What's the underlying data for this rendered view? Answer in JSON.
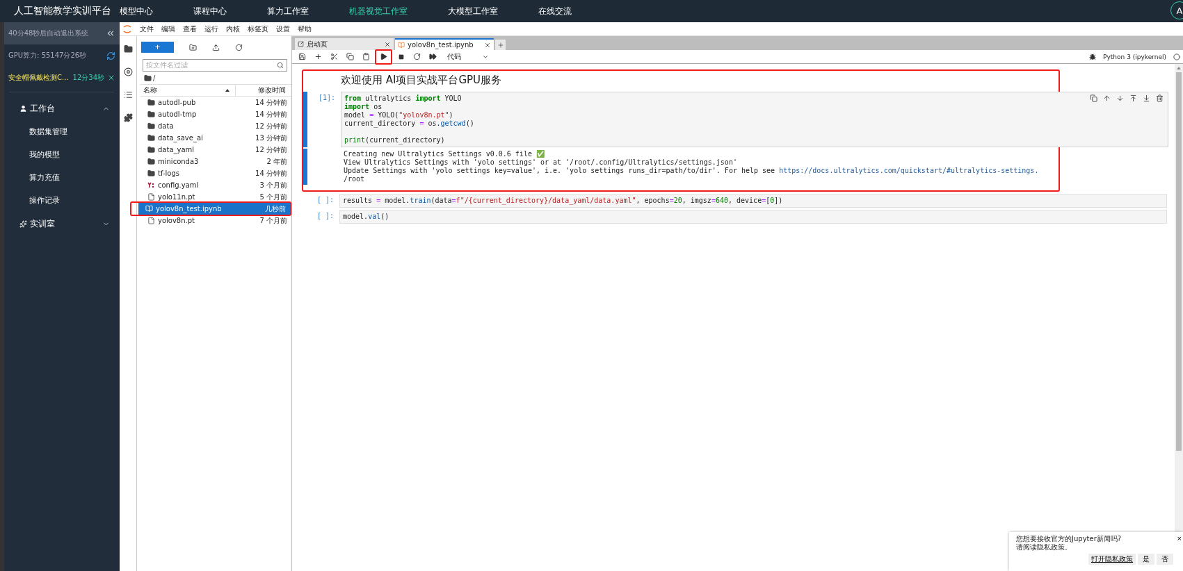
{
  "topbar": {
    "title": "人工智能教学实训平台",
    "avatar": "A",
    "nav": [
      {
        "label": "模型中心",
        "selected": false
      },
      {
        "label": "课程中心",
        "selected": false
      },
      {
        "label": "算力工作室",
        "selected": false
      },
      {
        "label": "机器视觉工作室",
        "selected": true
      },
      {
        "label": "大模型工作室",
        "selected": false
      },
      {
        "label": "在线交流",
        "selected": false
      }
    ]
  },
  "sidebar": {
    "timer": "40分48秒后自动退出系统",
    "gpu": "GPU算力: 55147分26秒",
    "task": {
      "name": "安全帽佩戴检测C...",
      "time": "12分34秒"
    },
    "sections": [
      {
        "label": "工作台",
        "kind": "workbench",
        "expanded": true,
        "children": [
          "数据集管理",
          "我的模型",
          "算力充值",
          "操作记录"
        ]
      },
      {
        "label": "实训室",
        "kind": "lab",
        "expanded": false
      }
    ]
  },
  "jupyter": {
    "menu": [
      "文件",
      "编辑",
      "查看",
      "运行",
      "内核",
      "标签页",
      "设置",
      "帮助"
    ],
    "filebrowser": {
      "new_button": "+",
      "filter_placeholder": "按文件名过滤",
      "path": "/",
      "columns": [
        "名称",
        "修改时间"
      ],
      "files": [
        {
          "name": "autodl-pub",
          "modified": "14 分钟前",
          "kind": "folder",
          "selected": false,
          "annotated": false
        },
        {
          "name": "autodl-tmp",
          "modified": "14 分钟前",
          "kind": "folder",
          "selected": false,
          "annotated": false
        },
        {
          "name": "data",
          "modified": "12 分钟前",
          "kind": "folder",
          "selected": false,
          "annotated": false
        },
        {
          "name": "data_save_ai",
          "modified": "13 分钟前",
          "kind": "folder",
          "selected": false,
          "annotated": false
        },
        {
          "name": "data_yaml",
          "modified": "12 分钟前",
          "kind": "folder",
          "selected": false,
          "annotated": false
        },
        {
          "name": "miniconda3",
          "modified": "2 年前",
          "kind": "folder",
          "selected": false,
          "annotated": false
        },
        {
          "name": "tf-logs",
          "modified": "14 分钟前",
          "kind": "folder",
          "selected": false,
          "annotated": false
        },
        {
          "name": "config.yaml",
          "modified": "3 个月前",
          "kind": "yaml",
          "selected": false,
          "annotated": false
        },
        {
          "name": "yolo11n.pt",
          "modified": "5 个月前",
          "kind": "file",
          "selected": false,
          "annotated": false
        },
        {
          "name": "yolov8n_test.ipynb",
          "modified": "几秒前",
          "kind": "notebook",
          "selected": true,
          "annotated": true
        },
        {
          "name": "yolov8n.pt",
          "modified": "7 个月前",
          "kind": "file",
          "selected": false,
          "annotated": false
        }
      ]
    },
    "tabs": [
      {
        "label": "启动页",
        "kind": "launcher",
        "selected": false
      },
      {
        "label": "yolov8n_test.ipynb",
        "kind": "notebook",
        "selected": true
      }
    ],
    "toolbar": {
      "buttons": [
        {
          "kind": "save",
          "annotated": false
        },
        {
          "kind": "add",
          "annotated": false
        },
        {
          "kind": "cut",
          "annotated": false
        },
        {
          "kind": "copy",
          "annotated": false
        },
        {
          "kind": "paste",
          "annotated": false
        },
        {
          "kind": "run",
          "annotated": true
        },
        {
          "kind": "stop",
          "annotated": false
        },
        {
          "kind": "restart",
          "annotated": false
        },
        {
          "kind": "run-all",
          "annotated": false
        }
      ],
      "cell_type": "代码",
      "kernel": "Python 3 (ipykernel)"
    },
    "cells": [
      {
        "kind": "markdown",
        "annotated": true,
        "selected": false,
        "text": "欢迎使用 AI项目实战平台GPU服务"
      },
      {
        "kind": "code",
        "annotated": true,
        "selected": true,
        "prompt": "[1]:",
        "lines": [
          {
            "parts": [
              {
                "kind": "keyword",
                "text": "from"
              },
              {
                "kind": "plain",
                "text": " ultralytics "
              },
              {
                "kind": "keyword",
                "text": "import"
              },
              {
                "kind": "plain",
                "text": " YOLO"
              }
            ]
          },
          {
            "parts": [
              {
                "kind": "keyword",
                "text": "import"
              },
              {
                "kind": "plain",
                "text": " os"
              }
            ]
          },
          {
            "parts": [
              {
                "kind": "plain",
                "text": "model "
              },
              {
                "kind": "operator",
                "text": "="
              },
              {
                "kind": "plain",
                "text": " YOLO("
              },
              {
                "kind": "string",
                "text": "\"yolov8n.pt\""
              },
              {
                "kind": "plain",
                "text": ")"
              }
            ]
          },
          {
            "parts": [
              {
                "kind": "plain",
                "text": "current_directory "
              },
              {
                "kind": "operator",
                "text": "="
              },
              {
                "kind": "plain",
                "text": " os."
              },
              {
                "kind": "function",
                "text": "getcwd"
              },
              {
                "kind": "plain",
                "text": "()"
              }
            ]
          },
          {
            "blank_before": true,
            "parts": [
              {
                "kind": "builtin",
                "text": "print"
              },
              {
                "kind": "plain",
                "text": "(current_directory)"
              }
            ]
          }
        ],
        "output": [
          {
            "text": "Creating new Ultralytics Settings v0.0.6 file ✅"
          },
          {
            "text": "View Ultralytics Settings with 'yolo settings' or at '/root/.config/Ultralytics/settings.json'"
          },
          {
            "text": "Update Settings with 'yolo settings key=value', i.e. 'yolo settings runs_dir=path/to/dir'. For help see ",
            "link": "https://docs.ultralytics.com/quickstart/#ultralytics-settings."
          },
          {
            "text": "/root"
          }
        ]
      },
      {
        "kind": "code",
        "annotated": false,
        "selected": false,
        "prompt": "[ ]:",
        "lines": [
          {
            "parts": [
              {
                "kind": "plain",
                "text": "results "
              },
              {
                "kind": "operator",
                "text": "="
              },
              {
                "kind": "plain",
                "text": " model."
              },
              {
                "kind": "function",
                "text": "train"
              },
              {
                "kind": "plain",
                "text": "(data"
              },
              {
                "kind": "operator",
                "text": "="
              },
              {
                "kind": "string",
                "text": "f\"/{current_directory}/data_yaml/data.yaml\""
              },
              {
                "kind": "plain",
                "text": ", epochs"
              },
              {
                "kind": "operator",
                "text": "="
              },
              {
                "kind": "number",
                "text": "20"
              },
              {
                "kind": "plain",
                "text": ", imgsz"
              },
              {
                "kind": "operator",
                "text": "="
              },
              {
                "kind": "number",
                "text": "640"
              },
              {
                "kind": "plain",
                "text": ", device"
              },
              {
                "kind": "operator",
                "text": "="
              },
              {
                "kind": "plain",
                "text": "["
              },
              {
                "kind": "number",
                "text": "0"
              },
              {
                "kind": "plain",
                "text": "])"
              }
            ]
          }
        ]
      },
      {
        "kind": "code",
        "annotated": false,
        "selected": false,
        "prompt": "[ ]:",
        "lines": [
          {
            "parts": [
              {
                "kind": "plain",
                "text": "model."
              },
              {
                "kind": "function",
                "text": "val"
              },
              {
                "kind": "plain",
                "text": "()"
              }
            ]
          }
        ]
      }
    ],
    "notification": {
      "lines": [
        "您想要接收官方的Jupyter新闻吗?",
        "请阅读隐私政策。"
      ],
      "link": "打开隐私政策",
      "buttons": [
        "是",
        "否"
      ],
      "close": "×"
    }
  }
}
